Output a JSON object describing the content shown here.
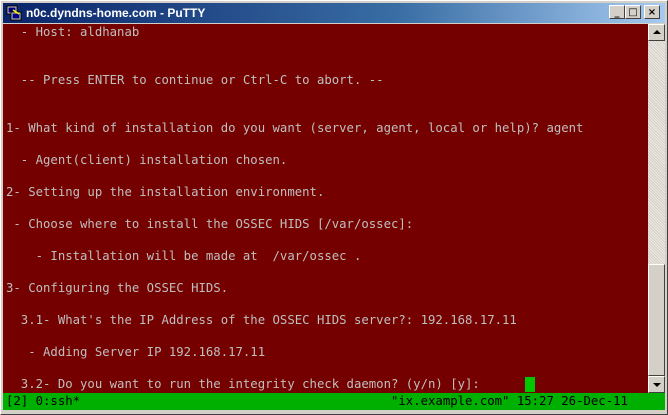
{
  "window": {
    "title": "n0c.dyndns-home.com - PuTTY",
    "minimize_glyph": "_",
    "maximize_glyph": "□",
    "close_glyph": "×"
  },
  "colors": {
    "terminal_background": "#750000",
    "terminal_text": "#bfbfbf",
    "cursor": "#00c800",
    "statusbar_background": "#00b000"
  },
  "terminal": {
    "lines": [
      "  - Host: aldhanab",
      "",
      "",
      "  -- Press ENTER to continue or Ctrl-C to abort. --",
      "",
      "",
      "1- What kind of installation do you want (server, agent, local or help)? agent",
      "",
      "  - Agent(client) installation chosen.",
      "",
      "2- Setting up the installation environment.",
      "",
      " - Choose where to install the OSSEC HIDS [/var/ossec]:",
      "",
      "    - Installation will be made at  /var/ossec .",
      "",
      "3- Configuring the OSSEC HIDS.",
      "",
      "  3.1- What's the IP Address of the OSSEC HIDS server?: 192.168.17.11",
      "",
      "   - Adding Server IP 192.168.17.11",
      "",
      "  3.2- Do you want to run the integrity check daemon? (y/n) [y]: "
    ]
  },
  "statusbar": {
    "left": "[2] 0:ssh*",
    "right": "\"ix.example.com\" 15:27 26-Dec-11"
  }
}
